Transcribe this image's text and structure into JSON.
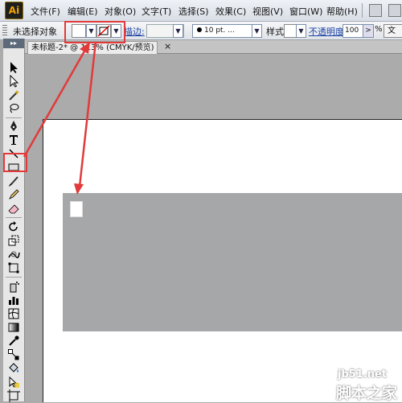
{
  "menubar": {
    "logo": "Ai",
    "items": [
      "文件(F)",
      "编辑(E)",
      "对象(O)",
      "文字(T)",
      "选择(S)",
      "效果(C)",
      "视图(V)",
      "窗口(W)",
      "帮助(H)"
    ]
  },
  "control_bar": {
    "selection_label": "未选择对象",
    "stroke_label": "描边:",
    "brush_value": "10 pt. ...",
    "style_label": "样式:",
    "opacity_label": "不透明度:",
    "opacity_value": "100",
    "opacity_unit": "%",
    "doc_button": "文"
  },
  "document_tab": {
    "title": "未标题-2* @ 113% (CMYK/预览)",
    "close": "×"
  },
  "toolbox": {
    "header": "▸▸",
    "active_tool": "rectangle-tool"
  },
  "canvas": {
    "shape_color": "#a6a7a9",
    "artboard_color": "#ffffff"
  },
  "annotation": {
    "highlight_color": "#e23a3a"
  },
  "watermark": {
    "site": "jb51.net",
    "text": "脚本之家"
  }
}
